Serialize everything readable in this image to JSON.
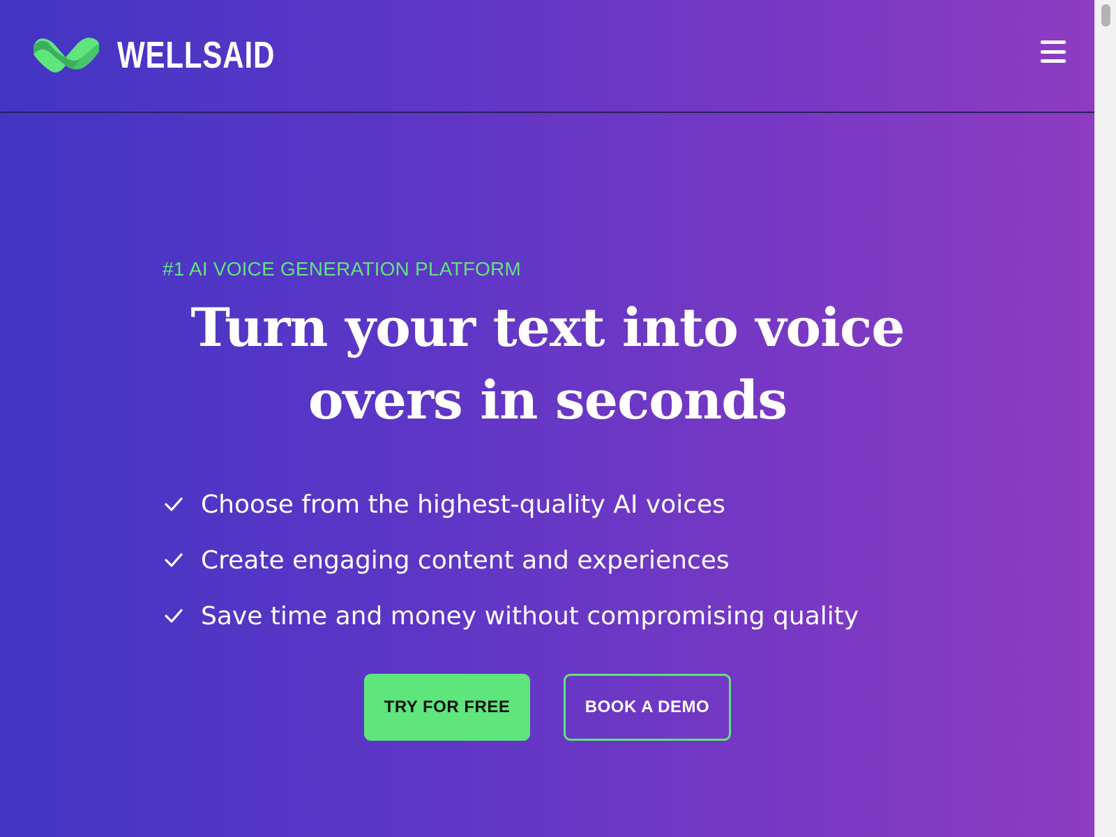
{
  "brand": {
    "name": "WELLSAID",
    "logo_icon": "wellsaid-wave-logo-icon",
    "accent_color": "#5ee67c"
  },
  "header": {
    "menu_icon": "hamburger-menu-icon"
  },
  "hero": {
    "eyebrow": "#1 AI VOICE GENERATION PLATFORM",
    "headline_line1": "Turn your text into voice",
    "headline_line2": "overs in seconds",
    "features": [
      {
        "icon": "check-icon",
        "text": "Choose from the highest-quality AI voices"
      },
      {
        "icon": "check-icon",
        "text": "Create engaging content and experiences"
      },
      {
        "icon": "check-icon",
        "text": "Save time and money without compromising quality"
      }
    ],
    "primary_cta": "TRY FOR FREE",
    "secondary_cta": "BOOK A DEMO"
  },
  "colors": {
    "gradient_start": "#4335c4",
    "gradient_end": "#8e3cc1",
    "text": "#ffffff"
  }
}
